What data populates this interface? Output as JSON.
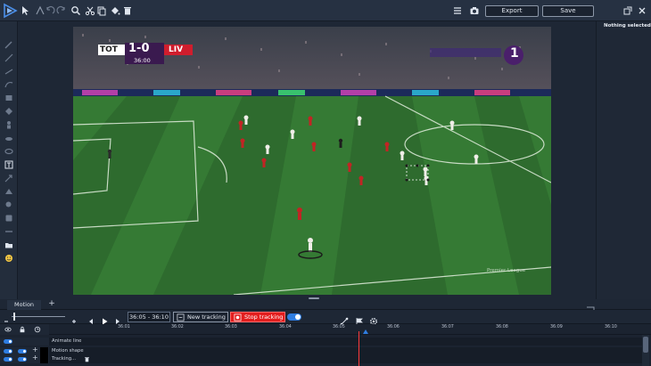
{
  "toolbar": {
    "export_label": "Export",
    "save_label": "Save"
  },
  "right_panel": {
    "selection_status": "Nothing selected"
  },
  "video": {
    "scorebug_home": "TOT",
    "scorebug_score": "1-0",
    "scorebug_away": "LIV",
    "scorebug_clock": "36:00",
    "broadcaster_badge": "1",
    "competition_watermark": "Premier League"
  },
  "timeline": {
    "tab_label": "Motion",
    "add_tab_label": "+",
    "time_range": "36:05 - 36:10",
    "new_tracking_label": "New tracking",
    "stop_tracking_label": "Stop tracking",
    "ruler_ticks": [
      "36:01",
      "36:02",
      "36:03",
      "36:04",
      "36:05",
      "36:06",
      "36:07",
      "36:08",
      "36:09",
      "36:10"
    ],
    "tracks": [
      {
        "label": "Animate line"
      },
      {
        "label": "Motion shape"
      },
      {
        "label": "Tracking..."
      }
    ]
  },
  "colors": {
    "accent": "#2f7de1",
    "record_red": "#e41e1e",
    "pitch_green": "#2e6b2e"
  }
}
